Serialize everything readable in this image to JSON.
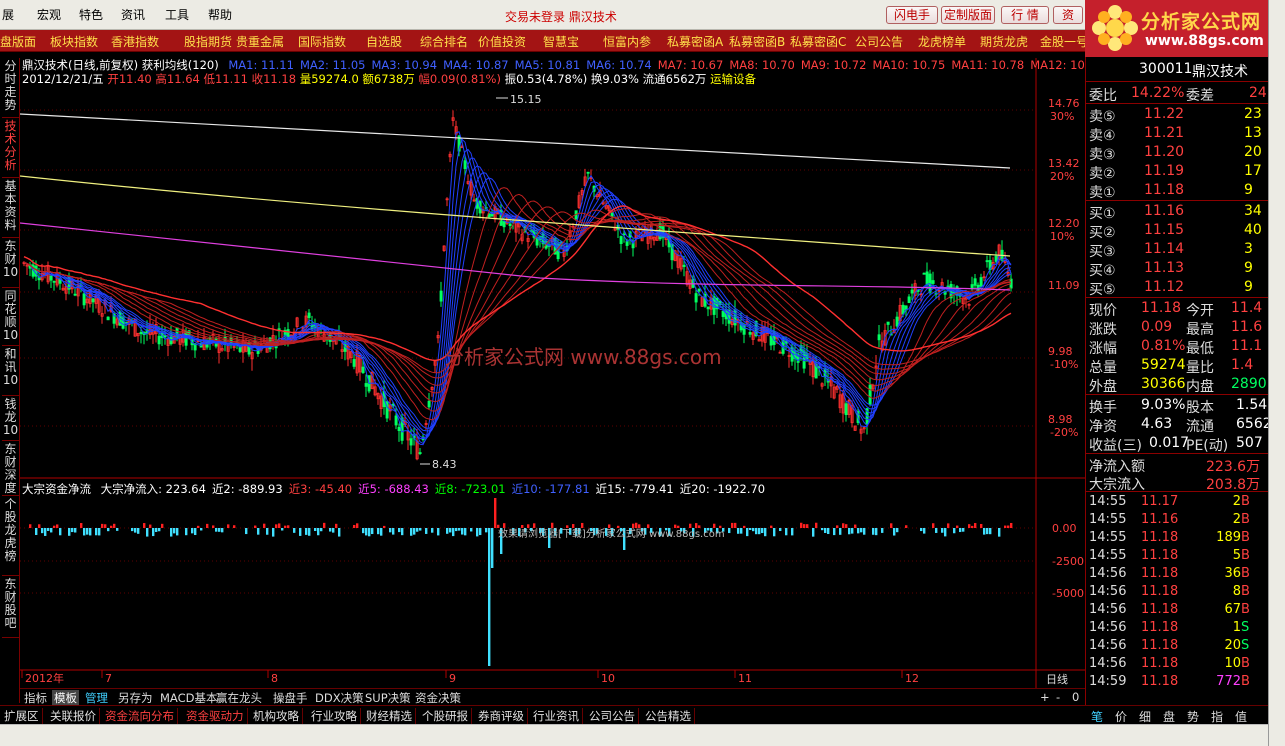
{
  "menu": {
    "items": [
      "展",
      "宏观",
      "特色",
      "资讯",
      "工具",
      "帮助"
    ],
    "title": "交易未登录  鼎汉技术",
    "buttons": [
      "闪电手",
      "定制版面",
      "行  情",
      "资"
    ]
  },
  "logo": {
    "name": "分析家公式网",
    "url": "www.88gs.com"
  },
  "tabs": [
    "盘版面",
    "板块指数",
    "香港指数",
    "股指期货",
    "贵重金属",
    "国际指数",
    "自选股",
    "综合排名",
    "价值投资",
    "智慧宝",
    "恒富内参",
    "私募密函A",
    "私募密函B",
    "私募密函C",
    "公司公告",
    "龙虎榜单",
    "期货龙虎",
    "金股一号"
  ],
  "left_tabs": [
    "分时走势",
    "技术分析",
    "基本资料",
    "东财10",
    "同花顺10",
    "和讯10",
    "钱龙10",
    "东财深度",
    "个股龙虎榜",
    "东财股吧"
  ],
  "chart_header": {
    "line1": "鼎汉技术(日线,前复权) 获利均线(120)",
    "ma": [
      "MA1: 11.11",
      "MA2: 11.05",
      "MA3: 10.94",
      "MA4: 10.87",
      "MA5: 10.81",
      "MA6: 10.74",
      "MA7: 10.67",
      "MA8: 10.70",
      "MA9: 10.72",
      "MA10: 10.75",
      "MA11: 10.78",
      "MA12: 10"
    ],
    "date": "2012/12/21/五",
    "open": "开11.40",
    "high": "高11.64",
    "low": "低11.11",
    "close": "收11.18",
    "vol": "量59274.0",
    "amt": "额6738万",
    "amp": "幅0.09(0.81%)",
    "zhen": "振0.53(4.78%)",
    "huan": "换9.03%",
    "liutong": "流通6562万",
    "sector": "运输设备"
  },
  "ddx_header": {
    "name": "大宗资金净流",
    "items": [
      {
        "label": "大宗净流入: 223.64",
        "color": "#ffffff"
      },
      {
        "label": "近2: -889.93",
        "color": "#ffffff"
      },
      {
        "label": "近3: -45.40",
        "color": "#ff4040"
      },
      {
        "label": "近5: -688.43",
        "color": "#ff40ff"
      },
      {
        "label": "近8: -723.01",
        "color": "#00ff00"
      },
      {
        "label": "近10: -177.81",
        "color": "#4060ff"
      },
      {
        "label": "近15: -779.41",
        "color": "#ffffff"
      },
      {
        "label": "近20: -1922.70",
        "color": "#ffffff"
      }
    ]
  },
  "watermark": "分析家公式网 www.88gs.com",
  "watermark2": "效果请浏览器[下载]分析家公式网 www.88gs.com",
  "price_axis": {
    "labels": [
      {
        "price": "14.76",
        "pct": "30%"
      },
      {
        "price": "13.42",
        "pct": "20%"
      },
      {
        "price": "12.20",
        "pct": "10%"
      },
      {
        "price": "11.09",
        "pct": ""
      },
      {
        "price": "9.98",
        "pct": "-10%"
      },
      {
        "price": "8.98",
        "pct": "-20%"
      }
    ]
  },
  "ind_axis": [
    "0.00",
    "-2500",
    "-5000"
  ],
  "peak_label": "15.15",
  "low_label": "8.43",
  "date_axis": [
    "2012年",
    "7",
    "8",
    "9",
    "10",
    "11",
    "12"
  ],
  "period": "日线",
  "bottom_tabs": [
    "指标",
    "模板",
    "管理",
    "另存为",
    "MACD基本",
    "赢在龙头",
    "操盘手",
    "DDX决策",
    "SUP决策",
    "资金决策"
  ],
  "zoom": [
    "+",
    "-",
    "0"
  ],
  "ext_tabs": [
    "扩展区",
    "关联报价",
    "资金流向分布",
    "资金驱动力",
    "机构攻略",
    "行业攻略",
    "财经精选",
    "个股研报",
    "券商评级",
    "行业资讯",
    "公司公告",
    "公告精选"
  ],
  "quote": {
    "code": "300011",
    "name": "鼎汉技术",
    "weibi": "14.22%",
    "weicha": "24",
    "sells": [
      {
        "label": "卖⑤",
        "price": "11.22",
        "vol": "23"
      },
      {
        "label": "卖④",
        "price": "11.21",
        "vol": "13"
      },
      {
        "label": "卖③",
        "price": "11.20",
        "vol": "20"
      },
      {
        "label": "卖②",
        "price": "11.19",
        "vol": "17"
      },
      {
        "label": "卖①",
        "price": "11.18",
        "vol": "9"
      }
    ],
    "buys": [
      {
        "label": "买①",
        "price": "11.16",
        "vol": "34"
      },
      {
        "label": "买②",
        "price": "11.15",
        "vol": "40"
      },
      {
        "label": "买③",
        "price": "11.14",
        "vol": "3"
      },
      {
        "label": "买④",
        "price": "11.13",
        "vol": "9"
      },
      {
        "label": "买⑤",
        "price": "11.12",
        "vol": "9"
      }
    ],
    "stats": [
      {
        "l1": "现价",
        "v1": "11.18",
        "l2": "今开",
        "v2": "11.4"
      },
      {
        "l1": "涨跌",
        "v1": "0.09",
        "l2": "最高",
        "v2": "11.6"
      },
      {
        "l1": "涨幅",
        "v1": "0.81%",
        "l2": "最低",
        "v2": "11.1"
      },
      {
        "l1": "总量",
        "v1": "59274",
        "l2": "量比",
        "v2": "1.4"
      },
      {
        "l1": "外盘",
        "v1": "30366",
        "l2": "内盘",
        "v2": "2890"
      }
    ],
    "stats2": [
      {
        "l1": "换手",
        "v1": "9.03%",
        "l2": "股本",
        "v2": "1.54"
      },
      {
        "l1": "净资",
        "v1": "4.63",
        "l2": "流通",
        "v2": "6562"
      },
      {
        "l1": "收益(三)",
        "v1": "0.017",
        "l2": "PE(动)",
        "v2": "507"
      }
    ],
    "flows": [
      {
        "label": "净流入额",
        "value": "223.6万"
      },
      {
        "label": "大宗流入",
        "value": "203.8万"
      }
    ],
    "ticks": [
      {
        "t": "14:55",
        "p": "11.17",
        "v": "2",
        "d": "B"
      },
      {
        "t": "14:55",
        "p": "11.16",
        "v": "2",
        "d": "B"
      },
      {
        "t": "14:55",
        "p": "11.18",
        "v": "189",
        "d": "B"
      },
      {
        "t": "14:55",
        "p": "11.18",
        "v": "5",
        "d": "B"
      },
      {
        "t": "14:56",
        "p": "11.18",
        "v": "36",
        "d": "B"
      },
      {
        "t": "14:56",
        "p": "11.18",
        "v": "8",
        "d": "B"
      },
      {
        "t": "14:56",
        "p": "11.18",
        "v": "67",
        "d": "B"
      },
      {
        "t": "14:56",
        "p": "11.18",
        "v": "1",
        "d": "S"
      },
      {
        "t": "14:56",
        "p": "11.18",
        "v": "20",
        "d": "S"
      },
      {
        "t": "14:56",
        "p": "11.18",
        "v": "10",
        "d": "B"
      },
      {
        "t": "14:59",
        "p": "11.18",
        "v": "772",
        "d": "B"
      }
    ]
  },
  "rp_bottom": [
    "笔",
    "价",
    "细",
    "盘",
    "势",
    "指",
    "值"
  ]
}
